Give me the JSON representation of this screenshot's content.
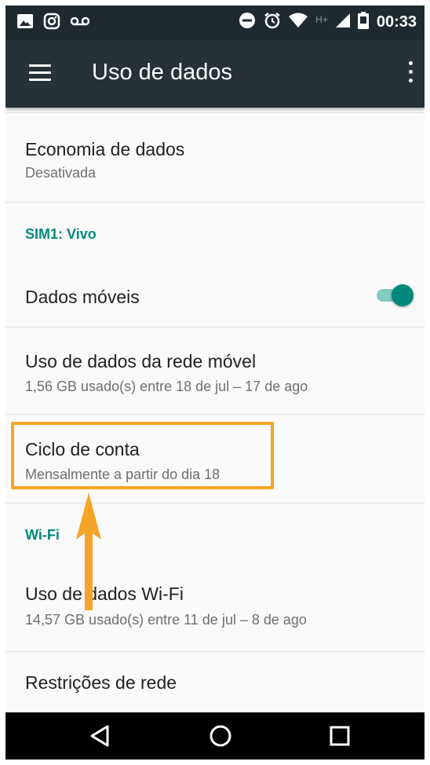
{
  "status_bar": {
    "time": "00:33",
    "network": "H+",
    "left_icons": [
      "image-icon",
      "instagram-icon",
      "voicemail-icon"
    ],
    "right_icons": [
      "do-not-disturb-icon",
      "alarm-icon",
      "wifi-icon",
      "signal-icon",
      "battery-icon"
    ]
  },
  "toolbar": {
    "title": "Uso de dados"
  },
  "items": {
    "data_saver": {
      "title": "Economia de dados",
      "summary": "Desativada"
    },
    "sim_category": "SIM1: Vivo",
    "mobile_data": {
      "title": "Dados móveis",
      "enabled": true
    },
    "mobile_usage": {
      "title": "Uso de dados da rede móvel",
      "summary": "1,56 GB usado(s) entre 18 de jul – 17 de ago"
    },
    "billing_cycle": {
      "title": "Ciclo de conta",
      "summary": "Mensalmente a partir do dia 18"
    },
    "wifi_category": "Wi-Fi",
    "wifi_usage": {
      "title": "Uso de dados Wi-Fi",
      "summary": "14,57 GB usado(s) entre 11 de jul – 8 de ago"
    },
    "network_restrictions": {
      "title": "Restrições de rede"
    }
  },
  "colors": {
    "toolbar": "#263238",
    "status_bar": "#1f2a30",
    "accent": "#00897b",
    "highlight": "#f7a428"
  },
  "nav": [
    "back-icon",
    "home-icon",
    "recents-icon"
  ]
}
